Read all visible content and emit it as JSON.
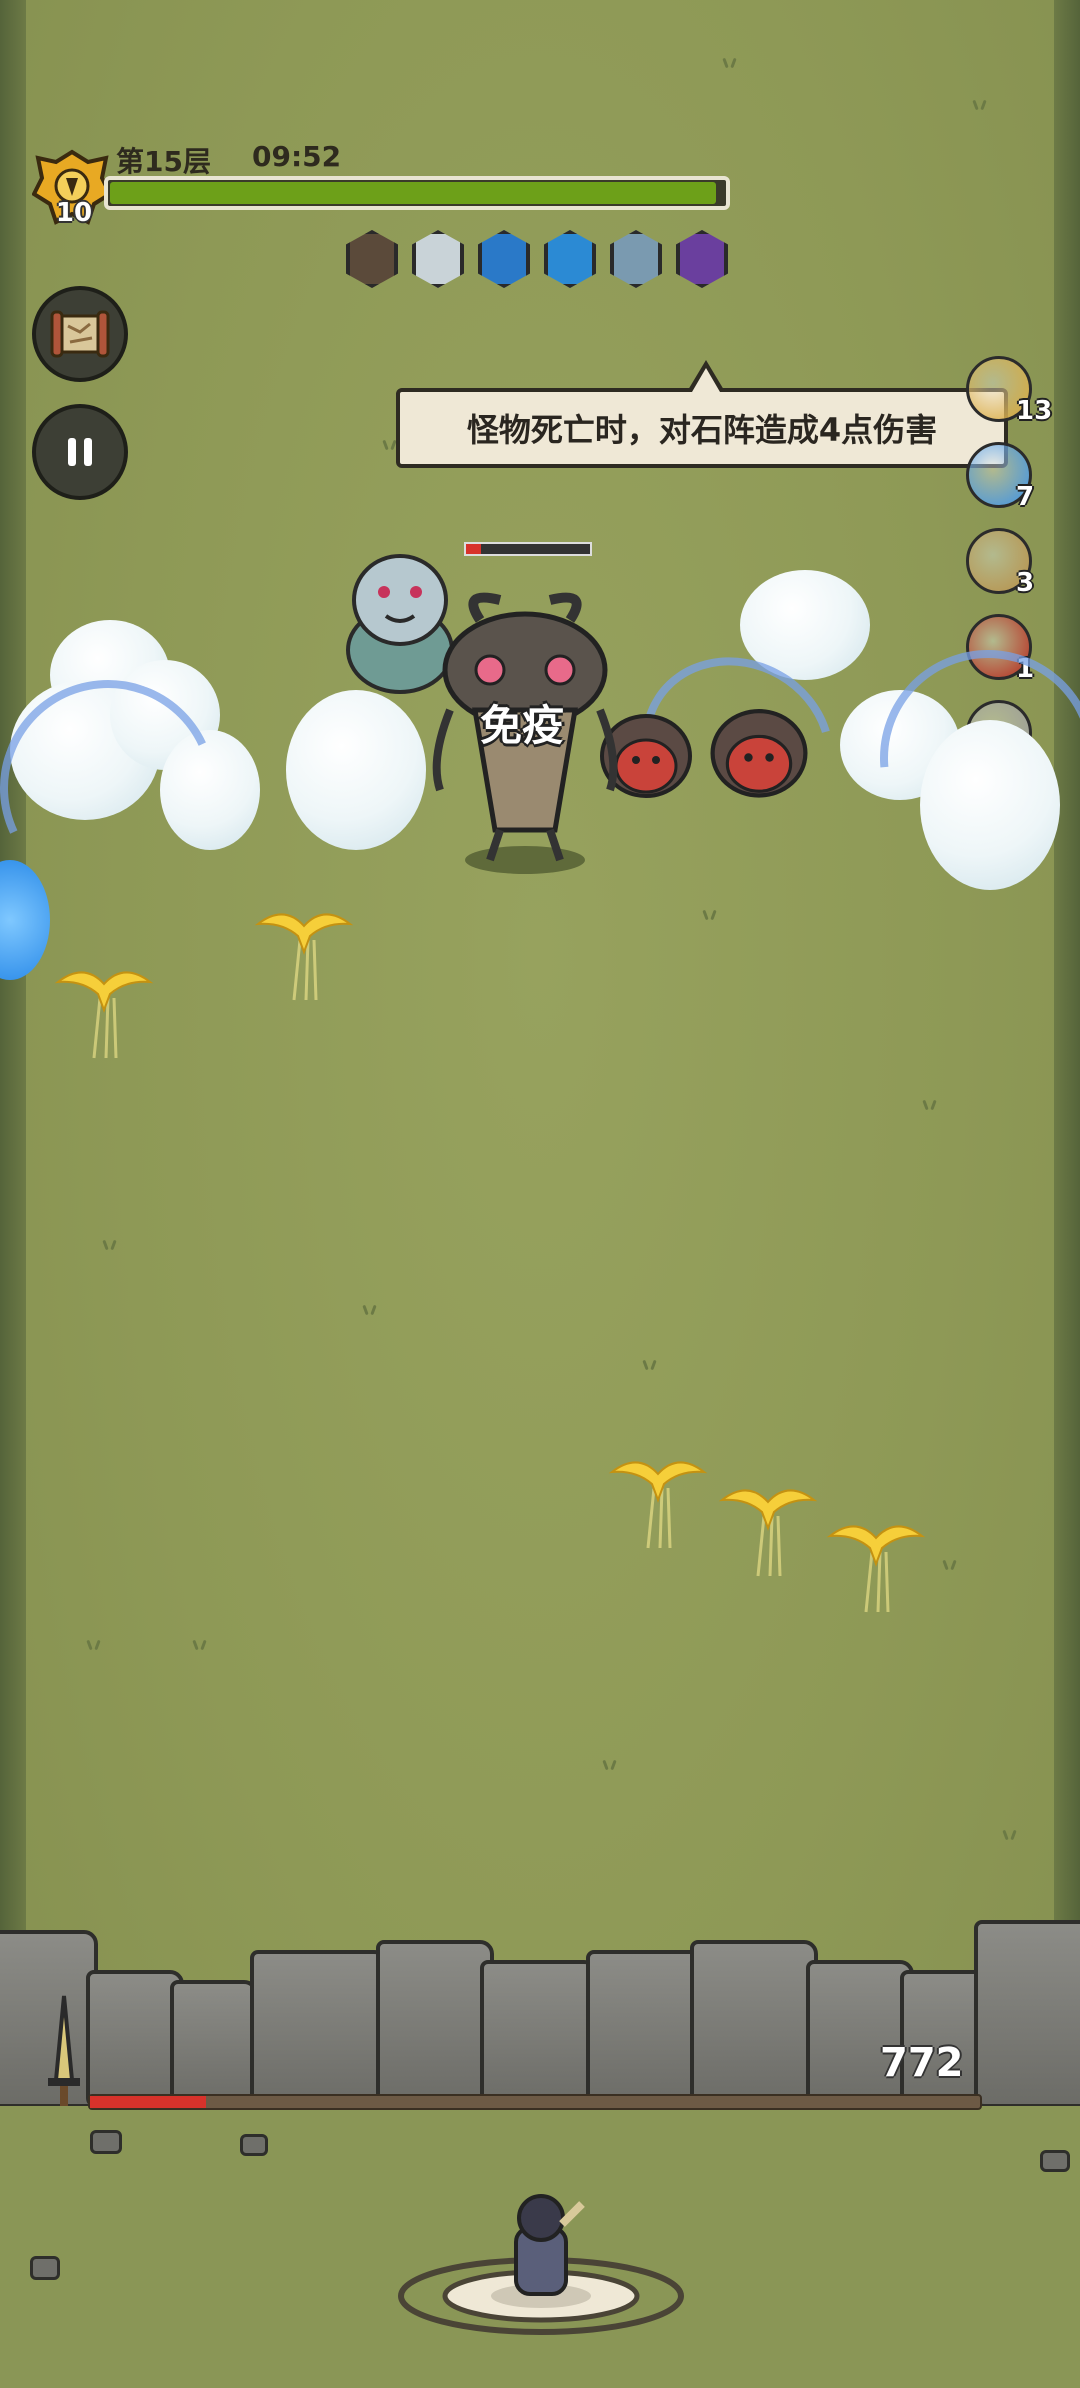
{
  "hud": {
    "player_level": "10",
    "floor": "第15层",
    "timer": "09:52",
    "progress": 0.98
  },
  "skills": [
    {
      "icon": "swirl-skill-icon",
      "color": "#5b4a3a"
    },
    {
      "icon": "ghost-skill-icon",
      "color": "#c9d3d8"
    },
    {
      "icon": "shield-skill-icon",
      "color": "#2a79c8"
    },
    {
      "icon": "fire-blue-skill-icon",
      "color": "#2b8ad4"
    },
    {
      "icon": "sword-skill-icon",
      "color": "#7a9ab0"
    },
    {
      "icon": "vortex-skill-icon",
      "color": "#6a3f9e"
    }
  ],
  "tooltip": "怪物死亡时，对石阵造成4点伤害",
  "buffs": [
    {
      "icon": "lightning-buff-icon",
      "count": "13",
      "color": "#d9a83a"
    },
    {
      "icon": "ice-buff-icon",
      "count": "7",
      "color": "#3d93e8"
    },
    {
      "icon": "claw-buff-icon",
      "count": "3",
      "color": "#b89048"
    },
    {
      "icon": "flame-buff-icon",
      "count": "1",
      "color": "#b8281c"
    },
    {
      "icon": "empty-buff-icon",
      "count": "",
      "color": "#9a9a9a"
    }
  ],
  "status_text": "免疫",
  "wall": {
    "hp": "772",
    "hp_fraction": 0.13
  },
  "colors": {
    "grass": "#8f9a58",
    "progress": "#6da019",
    "wall_hp": "#d8322b"
  }
}
